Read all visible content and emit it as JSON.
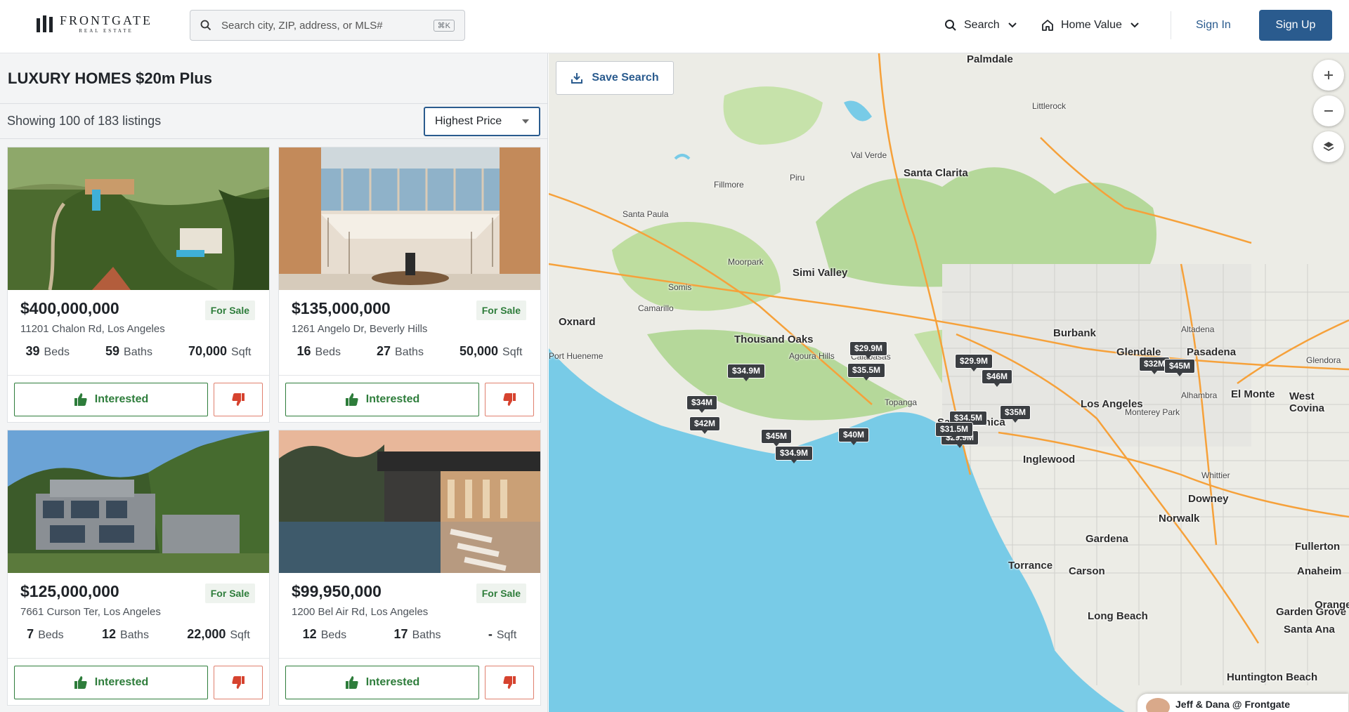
{
  "header": {
    "logo_name": "FRONTGATE",
    "logo_sub": "REAL ESTATE",
    "search_placeholder": "Search city, ZIP, address, or MLS#",
    "search_shortcut": "⌘K",
    "nav_search": "Search",
    "nav_home_value": "Home Value",
    "sign_in": "Sign In",
    "sign_up": "Sign Up"
  },
  "list": {
    "title": "LUXURY HOMES $20m Plus",
    "count_text": "Showing 100 of 183 listings",
    "sort_value": "Highest Price",
    "beds_label": "Beds",
    "baths_label": "Baths",
    "sqft_label": "Sqft",
    "interested_label": "Interested",
    "listings": [
      {
        "price": "$400,000,000",
        "status": "For Sale",
        "address": "11201 Chalon Rd, Los Angeles",
        "beds": "39",
        "baths": "59",
        "sqft": "70,000"
      },
      {
        "price": "$135,000,000",
        "status": "For Sale",
        "address": "1261 Angelo Dr, Beverly Hills",
        "beds": "16",
        "baths": "27",
        "sqft": "50,000"
      },
      {
        "price": "$125,000,000",
        "status": "For Sale",
        "address": "7661 Curson Ter, Los Angeles",
        "beds": "7",
        "baths": "12",
        "sqft": "22,000"
      },
      {
        "price": "$99,950,000",
        "status": "For Sale",
        "address": "1200 Bel Air Rd, Los Angeles",
        "beds": "12",
        "baths": "17",
        "sqft": "-"
      }
    ]
  },
  "map": {
    "save_search": "Save Search",
    "agent_label": "Jeff & Dana @ Frontgate",
    "cities": [
      "Palmdale",
      "Littlerock",
      "Val Verde",
      "Santa Clarita",
      "Piru",
      "Fillmore",
      "Santa Paula",
      "Moorpark",
      "Simi Valley",
      "Somis",
      "Camarillo",
      "Oxnard",
      "Thousand Oaks",
      "Agoura Hills",
      "Calabasas",
      "Topanga",
      "Burbank",
      "Glendale",
      "Pasadena",
      "Altadena",
      "Glendora",
      "Port Hueneme",
      "Los Angeles",
      "El Monte",
      "West Covina",
      "Alhambra",
      "Monterey Park",
      "Santa Monica",
      "Inglewood",
      "Whittier",
      "Downey",
      "Norwalk",
      "Gardena",
      "Fullerton",
      "Torrance",
      "Carson",
      "Anaheim",
      "Long Beach",
      "Garden Grove",
      "Santa Ana",
      "Huntington Beach",
      "Orange"
    ],
    "pins": [
      "$29.9M",
      "$34.9M",
      "$35.5M",
      "$34M",
      "$42M",
      "$45M",
      "$34.9M",
      "$40M",
      "$29.9M",
      "$34.5M",
      "$35M",
      "$31.5M",
      "$29.9M",
      "$32M",
      "$45M",
      "$46M"
    ]
  }
}
